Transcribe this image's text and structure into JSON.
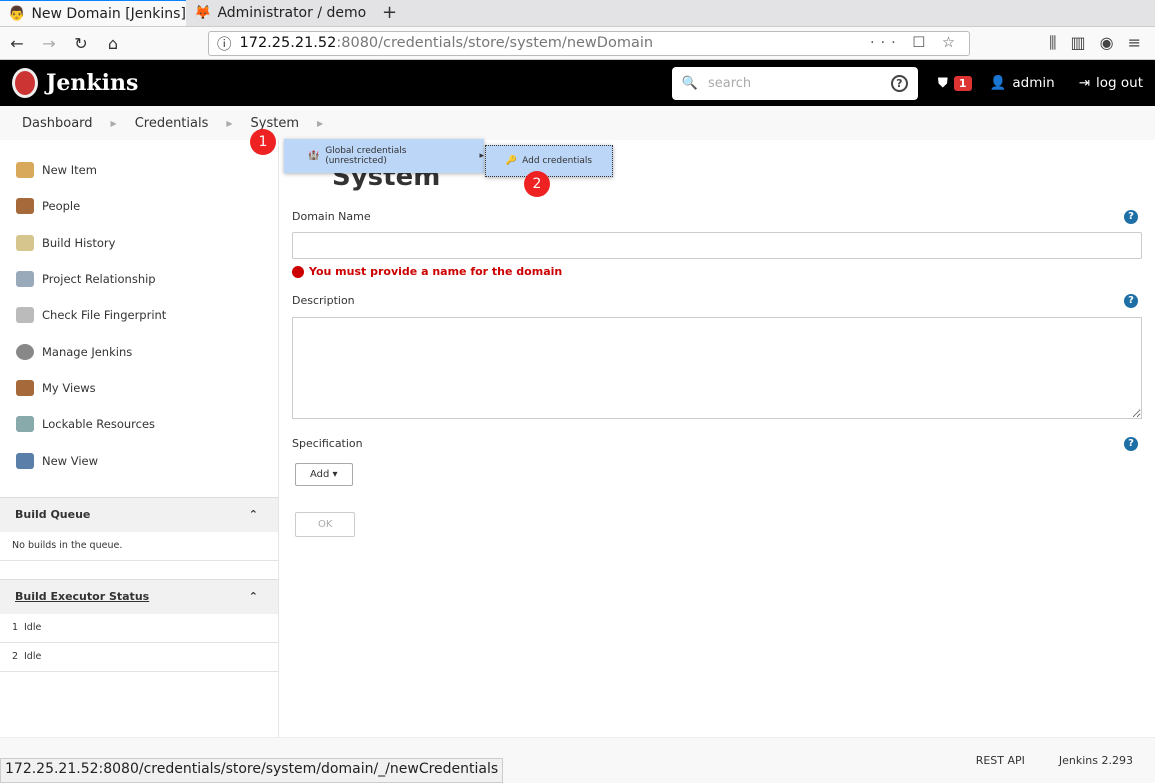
{
  "browser": {
    "tabs": [
      {
        "label": "New Domain [Jenkins]"
      },
      {
        "label": "Administrator / demo"
      }
    ],
    "url_host": "172.25.21.52",
    "url_rest": ":8080/credentials/store/system/newDomain",
    "status_url": "172.25.21.52:8080/credentials/store/system/domain/_/newCredentials"
  },
  "header": {
    "brand": "Jenkins",
    "search_placeholder": "search",
    "alert_count": "1",
    "user": "admin",
    "logout": "log out"
  },
  "breadcrumb": [
    "Dashboard",
    "Credentials",
    "System"
  ],
  "menu": {
    "item1": "Global credentials (unrestricted)",
    "item2": "Add credentials",
    "step1": "1",
    "step2": "2"
  },
  "sidebar": {
    "items": [
      {
        "label": "New Item"
      },
      {
        "label": "People"
      },
      {
        "label": "Build History"
      },
      {
        "label": "Project Relationship"
      },
      {
        "label": "Check File Fingerprint"
      },
      {
        "label": "Manage Jenkins"
      },
      {
        "label": "My Views"
      },
      {
        "label": "Lockable Resources"
      },
      {
        "label": "New View"
      }
    ],
    "build_queue": {
      "title": "Build Queue",
      "empty": "No builds in the queue."
    },
    "executors": {
      "title": "Build Executor Status",
      "rows": [
        {
          "n": "1",
          "s": "Idle"
        },
        {
          "n": "2",
          "s": "Idle"
        }
      ]
    }
  },
  "main": {
    "title": "System",
    "domain_name_label": "Domain Name",
    "domain_name_value": "",
    "error": "You must provide a name for the domain",
    "description_label": "Description",
    "specification_label": "Specification",
    "add_button": "Add ▾",
    "ok_button": "OK"
  },
  "footer": {
    "rest_api": "REST API",
    "version": "Jenkins 2.293"
  }
}
